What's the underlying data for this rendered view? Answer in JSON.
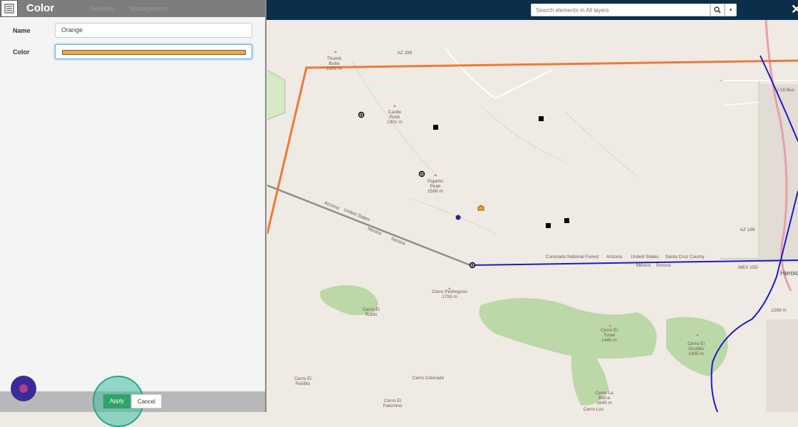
{
  "panel": {
    "title": "Color",
    "ghost_tabs": [
      "Desktop",
      "Management"
    ],
    "name_label": "Name",
    "name_value": "Orange",
    "color_label": "Color",
    "color_value": "#f0a83c",
    "apply_label": "Apply",
    "cancel_label": "Cancel"
  },
  "search": {
    "placeholder": "Search elements in All layers"
  },
  "map": {
    "labels": {
      "az289": "AZ 289",
      "thumb_butte": "Thumb",
      "thumb_butte2": "Butte",
      "thumb_butte_elev": "1302 m",
      "castle_rock": "Castle",
      "castle_rock2": "Rock",
      "castle_rock_elev": "1301 m",
      "pajarito": "Pajarito",
      "pajarito2": "Peak",
      "pajarito_elev": "1588 m",
      "arizona": "Arizona",
      "united_states": "United States",
      "mexico": "Mexico",
      "sonora": "Sonora",
      "coronado": "Coronado National Forest",
      "arizona2": "Arizona",
      "united_states2": "United States",
      "santa_cruz": "Santa Cruz County",
      "mexico2": "México",
      "sonora2": "Sonora",
      "cerro_pedregoso": "Cerro Pedregoso",
      "cerro_pedregoso_elev": "1753 m",
      "cerro_el_ruido": "Cerro El",
      "cerro_el_ruido2": "Ruido",
      "cerro_el_tunel": "Cerro El",
      "cerro_el_tunel2": "Tunel",
      "cerro_el_tunel_elev": "1445 m",
      "cerro_el_ocotillo": "Cerro El",
      "cerro_el_ocotillo2": "Ocotillo",
      "cerro_el_ocotillo_elev": "1435 m",
      "cerro_el_ruidito": "Cerro El",
      "cerro_el_ruidito2": "Ruidito",
      "cerro_colorado": "Cerro Colorado",
      "cerro_la_burra": "Cerro La",
      "cerro_la_burra2": "Burra",
      "cerro_la_burra_elev": "1645 m",
      "cerro_el_palomino": "Cerro El",
      "cerro_el_palomino2": "Palomino",
      "cerro_los": "Cerro Los",
      "i19bus": "I 19 Bus",
      "az189": "AZ 189",
      "mex15d": "MEX 15D",
      "heroica": "Heroic",
      "elev_1289": "1289 m"
    }
  },
  "colors": {
    "orange_line": "#f07838",
    "blue_line": "#1a1ad0",
    "gray_line": "#8e8e8e",
    "topbar": "#0b2e4a"
  }
}
